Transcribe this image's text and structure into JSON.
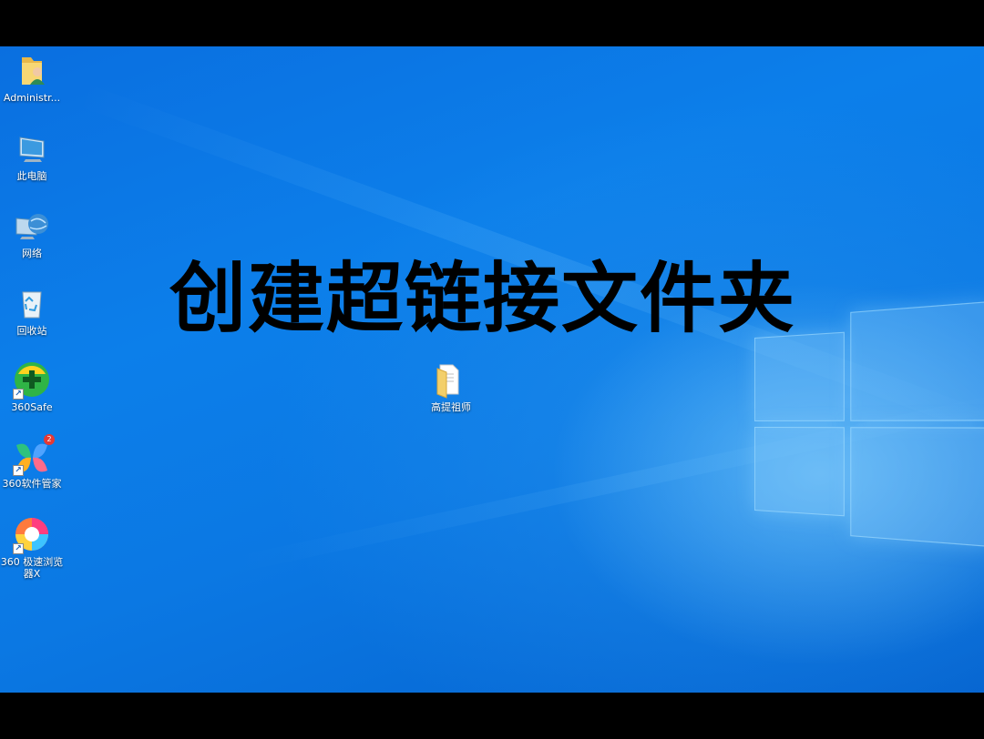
{
  "overlay_title": "创建超链接文件夹",
  "desktop_icons": [
    {
      "name": "administrator-folder",
      "label": "Administr...",
      "icon": "user-folder-icon"
    },
    {
      "name": "this-pc",
      "label": "此电脑",
      "icon": "computer-icon"
    },
    {
      "name": "network",
      "label": "网络",
      "icon": "network-globe-icon"
    },
    {
      "name": "recycle-bin",
      "label": "回收站",
      "icon": "recycle-bin-icon"
    },
    {
      "name": "360safe",
      "label": "360Safe",
      "icon": "360safe-icon"
    },
    {
      "name": "360-software-manager",
      "label": "360软件管家",
      "icon": "360-software-manager-icon",
      "badge": "2"
    },
    {
      "name": "360-browser",
      "label": "360 极速浏览器X",
      "icon": "360-browser-icon"
    }
  ],
  "center_folder": {
    "label": "高提祖师",
    "icon": "folder-icon"
  },
  "colors": {
    "desktop_blue": "#0b78e3",
    "badge_red": "#e53935",
    "folder_yellow": "#f3cf6a"
  }
}
